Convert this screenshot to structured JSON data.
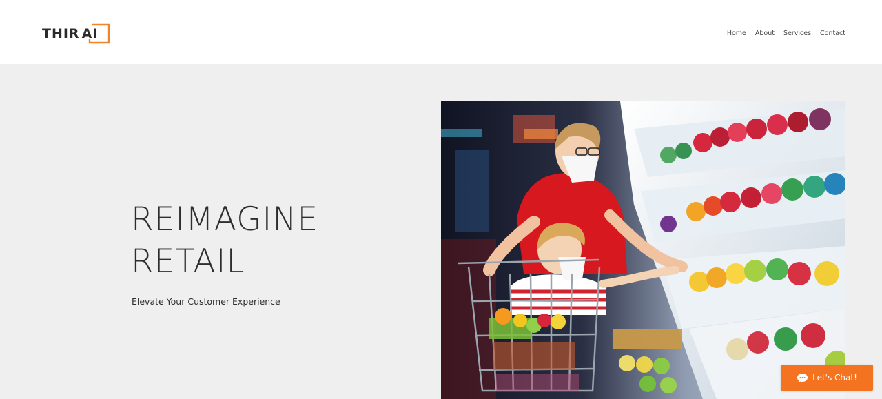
{
  "brand": {
    "logo_text_main": "THIR",
    "logo_text_boxed": "AI",
    "accent_color": "#f0842a"
  },
  "nav": {
    "items": [
      {
        "label": "Home"
      },
      {
        "label": "About"
      },
      {
        "label": "Services"
      },
      {
        "label": "Contact"
      }
    ]
  },
  "hero": {
    "title_line1": "REIMAGINE",
    "title_line2": "RETAIL",
    "subtitle": "Elevate Your Customer Experience",
    "image_alt": "Mother and child wearing face masks shopping for fruit in a supermarket"
  },
  "chat": {
    "label": "Let's Chat!",
    "icon": "chat-bubble-icon",
    "color": "#f47321"
  }
}
